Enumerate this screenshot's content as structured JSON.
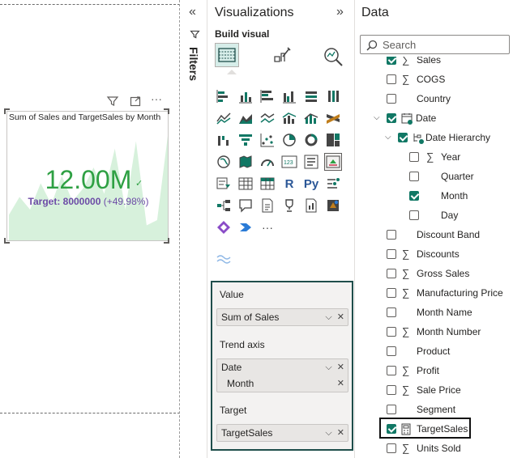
{
  "canvas": {
    "visual": {
      "title": "Sum of Sales and TargetSales by Month",
      "kpi_value": "12.00M",
      "target_label": "Target: 8000000",
      "target_delta": "(+49.98%)",
      "more_label": "···"
    },
    "colors": {
      "kpi_green": "#2ea043",
      "target_purple": "#6c4ba6",
      "trend_fill": "#c9ecd0"
    },
    "chart_data": {
      "type": "area",
      "values": [
        0.25,
        0.42,
        0.3,
        0.55,
        0.35,
        0.62,
        0.38,
        0.5,
        0.7,
        0.45,
        0.88,
        0.3,
        0.95,
        0.15,
        0.2,
        1.0
      ]
    }
  },
  "filters": {
    "label": "Filters"
  },
  "visualizations": {
    "title": "Visualizations",
    "build_label": "Build visual",
    "more_label": "···"
  },
  "wells": {
    "value": {
      "label": "Value",
      "field": "Sum of Sales"
    },
    "trend": {
      "label": "Trend axis",
      "field": "Date",
      "sub": "Month"
    },
    "target": {
      "label": "Target",
      "field": "TargetSales"
    }
  },
  "data": {
    "title": "Data",
    "search_placeholder": "Search",
    "fields": [
      {
        "name": "Sales",
        "checked": true,
        "sigma": true,
        "indent": 0
      },
      {
        "name": "COGS",
        "checked": false,
        "sigma": true,
        "indent": 0
      },
      {
        "name": "Country",
        "checked": false,
        "sigma": false,
        "indent": 0
      },
      {
        "name": "Date",
        "checked": true,
        "sigma": false,
        "indent": 0,
        "expand": true,
        "table": true
      },
      {
        "name": "Date Hierarchy",
        "checked": true,
        "sigma": false,
        "indent": 1,
        "expand": true,
        "hier": true
      },
      {
        "name": "Year",
        "checked": false,
        "sigma": true,
        "indent": 2
      },
      {
        "name": "Quarter",
        "checked": false,
        "sigma": false,
        "indent": 2
      },
      {
        "name": "Month",
        "checked": true,
        "sigma": false,
        "indent": 2
      },
      {
        "name": "Day",
        "checked": false,
        "sigma": false,
        "indent": 2
      },
      {
        "name": "Discount Band",
        "checked": false,
        "sigma": false,
        "indent": 0
      },
      {
        "name": "Discounts",
        "checked": false,
        "sigma": true,
        "indent": 0
      },
      {
        "name": "Gross Sales",
        "checked": false,
        "sigma": true,
        "indent": 0
      },
      {
        "name": "Manufacturing Price",
        "checked": false,
        "sigma": true,
        "indent": 0
      },
      {
        "name": "Month Name",
        "checked": false,
        "sigma": false,
        "indent": 0
      },
      {
        "name": "Month Number",
        "checked": false,
        "sigma": true,
        "indent": 0
      },
      {
        "name": "Product",
        "checked": false,
        "sigma": false,
        "indent": 0
      },
      {
        "name": "Profit",
        "checked": false,
        "sigma": true,
        "indent": 0
      },
      {
        "name": "Sale Price",
        "checked": false,
        "sigma": true,
        "indent": 0
      },
      {
        "name": "Segment",
        "checked": false,
        "sigma": false,
        "indent": 0
      },
      {
        "name": "TargetSales",
        "checked": true,
        "sigma": false,
        "indent": 0,
        "calc": true
      },
      {
        "name": "Units Sold",
        "checked": false,
        "sigma": true,
        "indent": 0
      }
    ]
  }
}
